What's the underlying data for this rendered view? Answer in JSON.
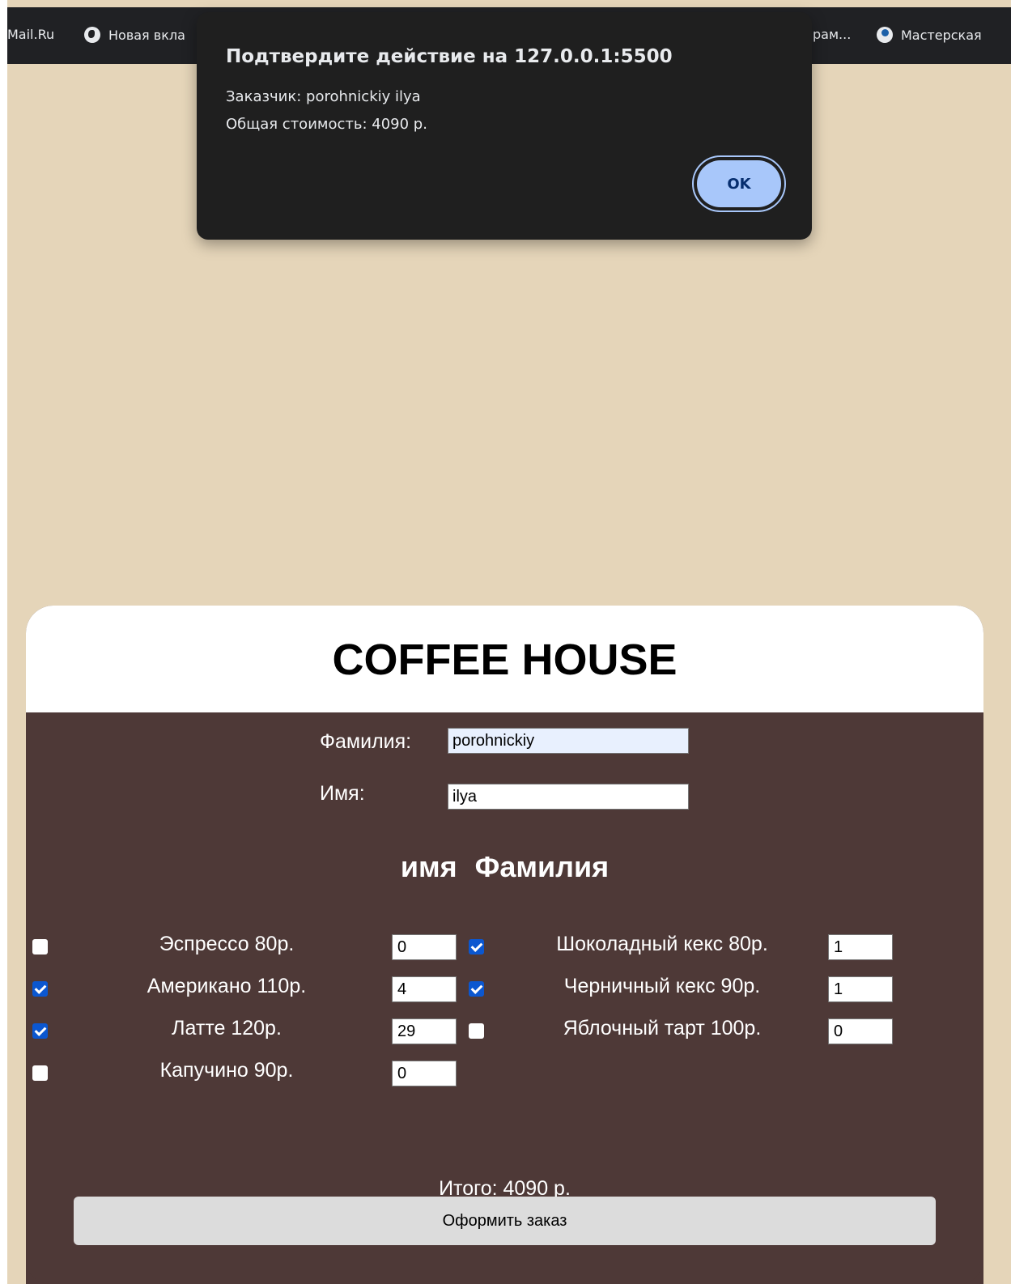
{
  "bookmarks": {
    "items": [
      {
        "label": "Mail.Ru",
        "icon": "none"
      },
      {
        "label": "Новая вкла",
        "icon": "globe-icon"
      },
      {
        "label": "рам...",
        "icon": "none"
      },
      {
        "label": "Мастерская",
        "icon": "steam-icon"
      }
    ]
  },
  "dialog": {
    "title": "Подтвердите действие на 127.0.0.1:5500",
    "line1": "Заказчик: porohnickiy ilya",
    "line2": "Общая стоимость: 4090 р.",
    "ok_label": "OK"
  },
  "form": {
    "title": "COFFEE HOUSE",
    "surname_label": "Фамилия:",
    "surname_value": "porohnickiy",
    "name_label": "Имя:",
    "name_value": "ilya",
    "subheading": "имя Фамилия",
    "drinks": [
      {
        "label": "Эспрессо 80р.",
        "checked": false,
        "qty": "0"
      },
      {
        "label": "Американо 110р.",
        "checked": true,
        "qty": "4"
      },
      {
        "label": "Латте 120р.",
        "checked": true,
        "qty": "29"
      },
      {
        "label": "Капучино 90р.",
        "checked": false,
        "qty": "0"
      }
    ],
    "desserts": [
      {
        "label": "Шоколадный кекс 80р.",
        "checked": true,
        "qty": "1"
      },
      {
        "label": "Черничный кекс 90р.",
        "checked": true,
        "qty": "1"
      },
      {
        "label": "Яблочный тарт 100р.",
        "checked": false,
        "qty": "0"
      }
    ],
    "total_text": "Итого: 4090 р.",
    "submit_label": "Оформить заказ"
  },
  "colors": {
    "page_background": "#e5d5b9",
    "card_body": "#4e3937",
    "dialog_background": "#1f1f1f",
    "dialog_button": "#a8c7fa",
    "checkbox_checked": "#0b57d0",
    "submit_button": "#dcdcdc"
  }
}
